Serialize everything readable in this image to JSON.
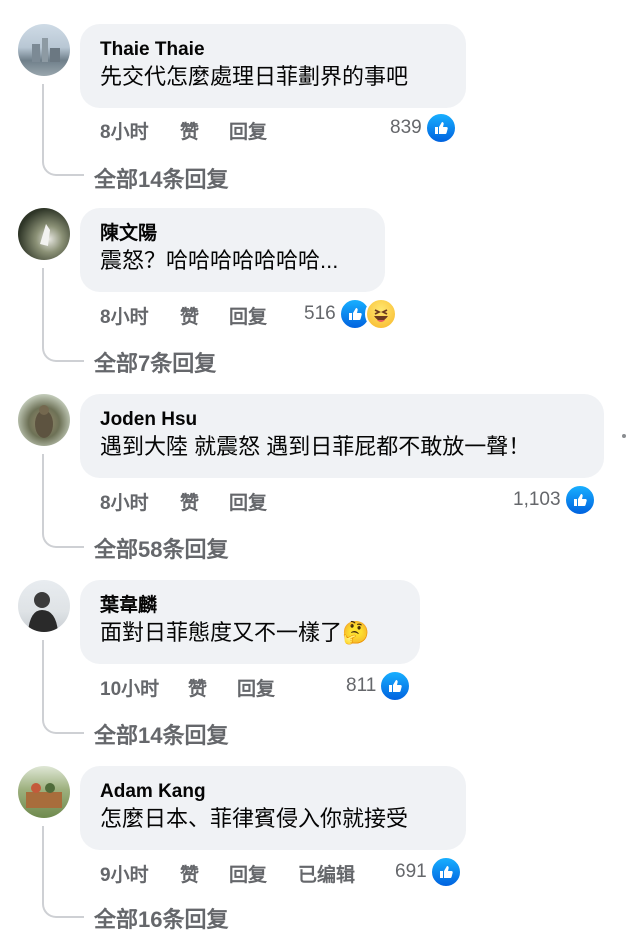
{
  "comments": [
    {
      "author": "Thaie Thaie",
      "text": "先交代怎麼處理日菲劃界的事吧",
      "time": "8小时",
      "like": "赞",
      "reply": "回复",
      "edited": "",
      "reaction_count": "839",
      "replies": "全部14条回复"
    },
    {
      "author": "陳文陽",
      "text": "震怒？哈哈哈哈哈哈哈...",
      "time": "8小时",
      "like": "赞",
      "reply": "回复",
      "edited": "",
      "reaction_count": "516",
      "replies": "全部7条回复"
    },
    {
      "author": "Joden Hsu",
      "text": "遇到大陸 就震怒 遇到日菲屁都不敢放一聲！",
      "time": "8小时",
      "like": "赞",
      "reply": "回复",
      "edited": "",
      "reaction_count": "1,103",
      "replies": "全部58条回复"
    },
    {
      "author": "葉韋麟",
      "text": "面對日菲態度又不一樣了",
      "text_emoji": "🤔",
      "time": "10小时",
      "like": "赞",
      "reply": "回复",
      "edited": "",
      "reaction_count": "811",
      "replies": "全部14条回复"
    },
    {
      "author": "Adam Kang",
      "text": "怎麼日本、菲律賓侵入你就接受",
      "time": "9小时",
      "like": "赞",
      "reply": "回复",
      "edited": "已编辑",
      "reaction_count": "691",
      "replies": "全部16条回复"
    }
  ],
  "icons": {
    "like": "like-icon",
    "haha": "haha-icon",
    "thinking": "thinking-emoji"
  },
  "colors": {
    "bubble": "#f0f2f5",
    "meta": "#65676b",
    "like": "#0866ff"
  }
}
